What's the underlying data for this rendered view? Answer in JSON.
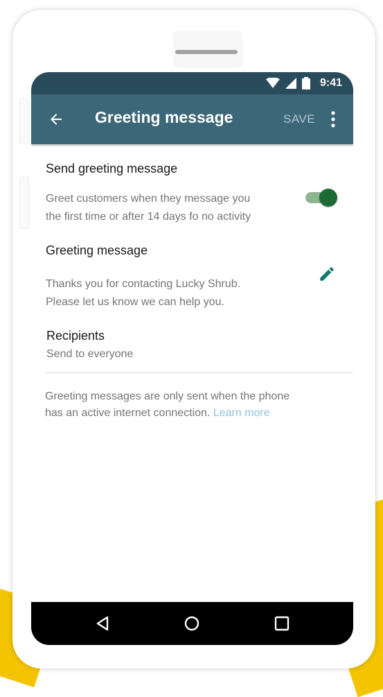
{
  "status_bar": {
    "time": "9:41"
  },
  "app_bar": {
    "title": "Greeting message",
    "save_label": "SAVE"
  },
  "settings": {
    "send_greeting": {
      "title": "Send greeting message",
      "description_line1": "Greet customers when they message you",
      "description_line2": "the first time or after 14 days fo no activity",
      "toggle_on": true
    },
    "greeting_message": {
      "title": "Greeting message",
      "text_line1": "Thanks you for contacting Lucky Shrub.",
      "text_line2": "Please let us know we can help you."
    },
    "recipients": {
      "title": "Recipients",
      "value": "Send to everyone"
    },
    "footer": {
      "note_line1": "Greeting messages are only sent when the phone",
      "note_line2": "has an active internet connection.",
      "link": "Learn more"
    }
  },
  "icons": {
    "back": "arrow-left-icon",
    "more": "more-vertical-icon",
    "edit": "pencil-icon",
    "wifi": "wifi-icon",
    "signal": "signal-icon",
    "battery": "battery-icon",
    "nav_back": "triangle-back-icon",
    "nav_home": "circle-home-icon",
    "nav_recents": "square-recents-icon"
  },
  "colors": {
    "status_bar": "#2a4b5c",
    "app_bar": "#3c6778",
    "accent_green": "#1d6b34",
    "edit_icon": "#127a6e",
    "link": "#8fc1e0",
    "background_accent": "#f4c400"
  }
}
